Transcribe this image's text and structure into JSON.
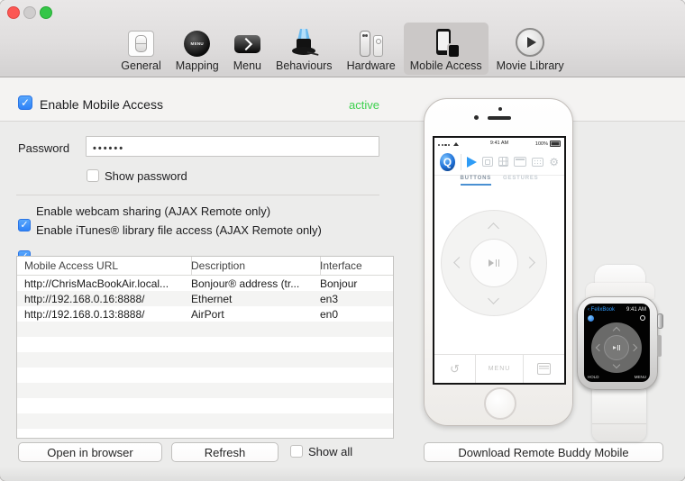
{
  "toolbar": {
    "items": [
      {
        "label": "General",
        "selected": false
      },
      {
        "label": "Mapping",
        "selected": false
      },
      {
        "label": "Menu",
        "selected": false
      },
      {
        "label": "Behaviours",
        "selected": false
      },
      {
        "label": "Hardware",
        "selected": false
      },
      {
        "label": "Mobile Access",
        "selected": true
      },
      {
        "label": "Movie Library",
        "selected": false
      }
    ]
  },
  "panel": {
    "enable_label": "Enable Mobile Access",
    "enable_checked": true,
    "status_text": "active",
    "status_color": "#3ed14f",
    "password_label": "Password",
    "password_value": "••••••",
    "show_password_label": "Show password",
    "show_password_checked": false,
    "options": [
      {
        "label": "Enable webcam sharing (AJAX Remote only)",
        "checked": true
      },
      {
        "label": "Enable iTunes® library file access (AJAX Remote only)",
        "checked": true
      }
    ]
  },
  "table": {
    "columns": [
      "Mobile Access URL",
      "Description",
      "Interface"
    ],
    "rows": [
      [
        "http://ChrisMacBookAir.local...",
        "Bonjour® address (tr...",
        "Bonjour"
      ],
      [
        "http://192.168.0.16:8888/",
        "Ethernet",
        "en3"
      ],
      [
        "http://192.168.0.13:8888/",
        "AirPort",
        "en0"
      ]
    ]
  },
  "actions": {
    "open_in_browser": "Open in browser",
    "refresh": "Refresh",
    "show_all_label": "Show all",
    "show_all_checked": false,
    "download": "Download Remote Buddy Mobile"
  },
  "phone": {
    "time": "9:41 AM",
    "battery": "100%",
    "tabs": [
      {
        "label": "BUTTONS",
        "active": true
      },
      {
        "label": "GESTURES",
        "active": false
      }
    ],
    "menu_label": "MENU",
    "icons": {
      "app_logo": "Q",
      "rotate": "↺",
      "gear": "⚙"
    }
  },
  "watch": {
    "back_label": "‹ FelixBook",
    "time": "9:41 AM",
    "hold_label": "HOLD",
    "menu_label": "MENU"
  },
  "colors": {
    "checkbox_blue": "#3b99fc",
    "active_green": "#3ed14f",
    "tab_underline": "#4a90d2"
  }
}
